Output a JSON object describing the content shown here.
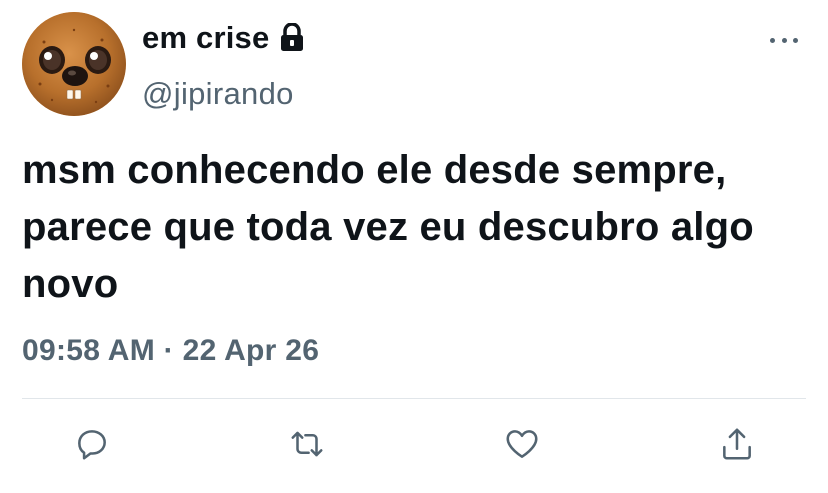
{
  "tweet": {
    "author": {
      "display_name": "em crise",
      "handle": "@jipirando",
      "avatar_icon": "cookie-character-avatar",
      "protected_icon": "lock-icon"
    },
    "menu_icon": "more-horizontal-icon",
    "text": "msm conhecendo ele desde sempre, parece que toda vez eu descubro algo novo",
    "time": "09:58 AM",
    "separator": "·",
    "date": "22 Apr 26"
  },
  "actions": [
    {
      "icon": "reply-icon"
    },
    {
      "icon": "retweet-icon"
    },
    {
      "icon": "like-icon"
    },
    {
      "icon": "share-icon"
    }
  ],
  "colors": {
    "text_primary": "#0f1419",
    "text_secondary": "#536471",
    "divider": "#e1e6ea",
    "icon": "#536471"
  }
}
